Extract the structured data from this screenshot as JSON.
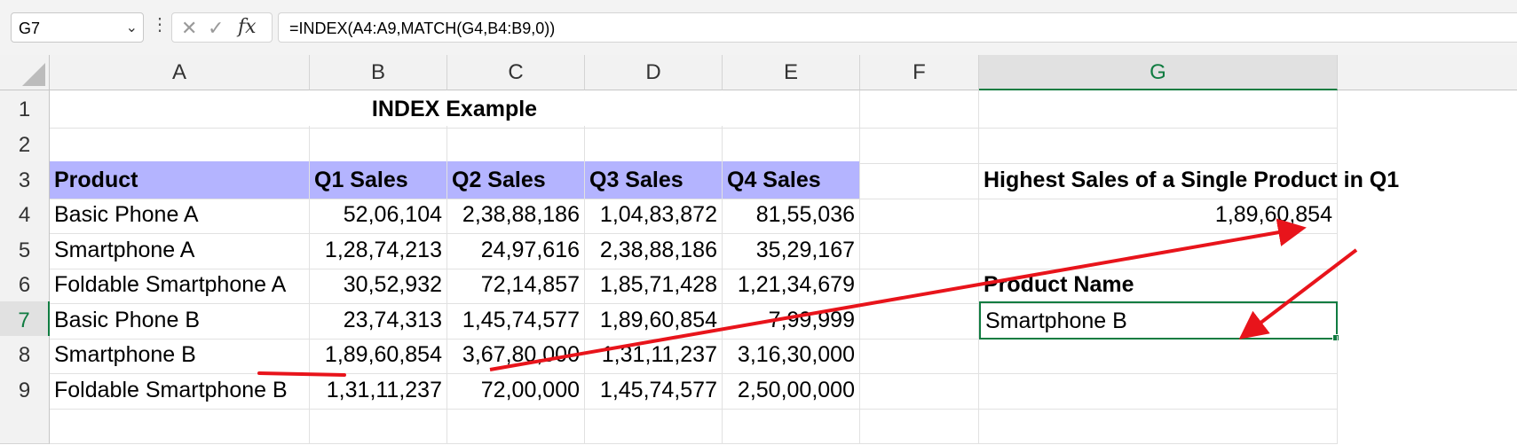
{
  "formula_bar": {
    "name_box": "G7",
    "formula": "=INDEX(A4:A9,MATCH(G4,B4:B9,0))",
    "fx_label": "fx"
  },
  "columns": [
    "A",
    "B",
    "C",
    "D",
    "E",
    "F",
    "G"
  ],
  "rows": [
    "1",
    "2",
    "3",
    "4",
    "5",
    "6",
    "7",
    "8",
    "9"
  ],
  "title": "INDEX Example",
  "table": {
    "headers": [
      "Product",
      "Q1 Sales",
      "Q2 Sales",
      "Q3 Sales",
      "Q4 Sales"
    ],
    "rows": [
      [
        "Basic Phone A",
        "52,06,104",
        "2,38,88,186",
        "1,04,83,872",
        "81,55,036"
      ],
      [
        "Smartphone A",
        "1,28,74,213",
        "24,97,616",
        "2,38,88,186",
        "35,29,167"
      ],
      [
        "Foldable Smartphone A",
        "30,52,932",
        "72,14,857",
        "1,85,71,428",
        "1,21,34,679"
      ],
      [
        "Basic Phone B",
        "23,74,313",
        "1,45,74,577",
        "1,89,60,854",
        "7,99,999"
      ],
      [
        "Smartphone B",
        "1,89,60,854",
        "3,67,80,000",
        "1,31,11,237",
        "3,16,30,000"
      ],
      [
        "Foldable Smartphone B",
        "1,31,11,237",
        "72,00,000",
        "1,45,74,577",
        "2,50,00,000"
      ]
    ]
  },
  "side": {
    "g3_label": "Highest Sales of a Single Product in Q1",
    "g4_value": "1,89,60,854",
    "g6_label": "Product Name",
    "g7_value": "Smartphone B"
  },
  "colors": {
    "header_fill": "#b4b4ff",
    "selection": "#107c41",
    "annotation": "#e8141b"
  }
}
